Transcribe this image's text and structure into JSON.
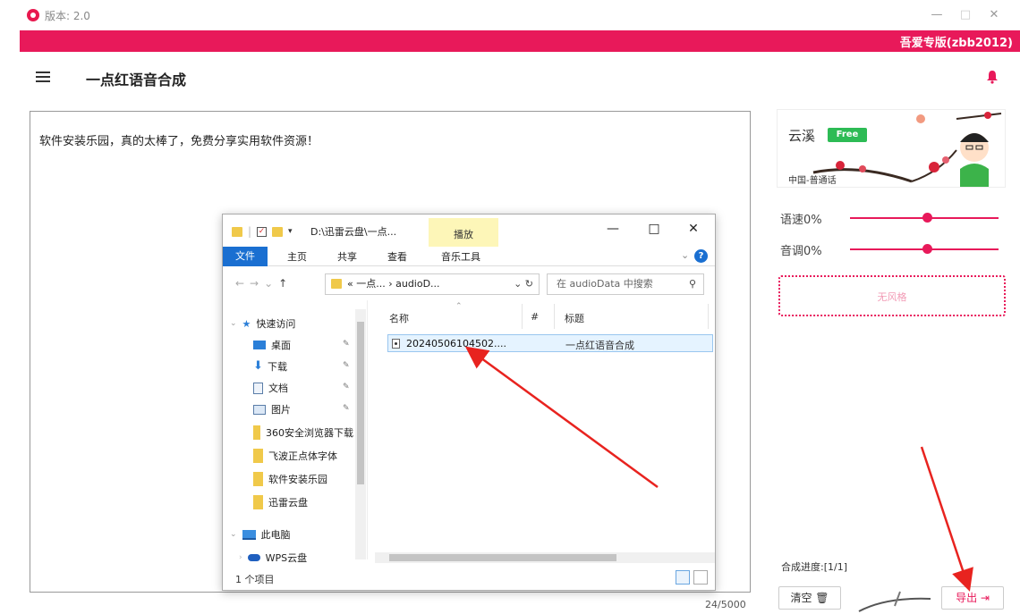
{
  "window": {
    "version_label": "版本: 2.0",
    "minimize": "—",
    "maximize": "□",
    "close": "✕"
  },
  "banner": {
    "vip_label": "吾爱专版(zbb2012)"
  },
  "header": {
    "title": "一点红语音合成"
  },
  "editor": {
    "text": "软件安装乐园，真的太棒了，免费分享实用软件资源！",
    "char_count": "24/5000"
  },
  "voice": {
    "name": "云溪",
    "badge": "Free",
    "region": "中国-普通话"
  },
  "sliders": [
    {
      "label": "语速0%",
      "value": 0.52
    },
    {
      "label": "音调0%",
      "value": 0.52
    }
  ],
  "style": {
    "label": "无风格"
  },
  "progress": {
    "label": "合成进度:[1/1]"
  },
  "buttons": {
    "clear": "清空 🗑",
    "export": "导出 ⇥"
  },
  "explorer": {
    "path": "D:\\迅雷云盘\\一点...",
    "play_tab": "播放",
    "tabs": [
      "文件",
      "主页",
      "共享",
      "查看",
      "音乐工具"
    ],
    "help": "?",
    "address": "« 一点... › audioD...",
    "search_placeholder": "在 audioData 中搜索",
    "nav": {
      "quick_access": "快速访问",
      "items": [
        "桌面",
        "下载",
        "文档",
        "图片"
      ],
      "folders": [
        "360安全浏览器下载",
        "飞波正点体字体",
        "软件安装乐园",
        "迅雷云盘"
      ],
      "this_pc": "此电脑",
      "wps": "WPS云盘"
    },
    "columns": {
      "name": "名称",
      "number": "#",
      "title": "标题"
    },
    "file": {
      "name": "20240506104502....",
      "title": "一点红语音合成"
    },
    "status": "1 个项目"
  },
  "colors": {
    "accent": "#e8195a",
    "free": "#2dbb55",
    "arrow": "#e8231f",
    "explorer_file_tab": "#1a6fd1"
  }
}
